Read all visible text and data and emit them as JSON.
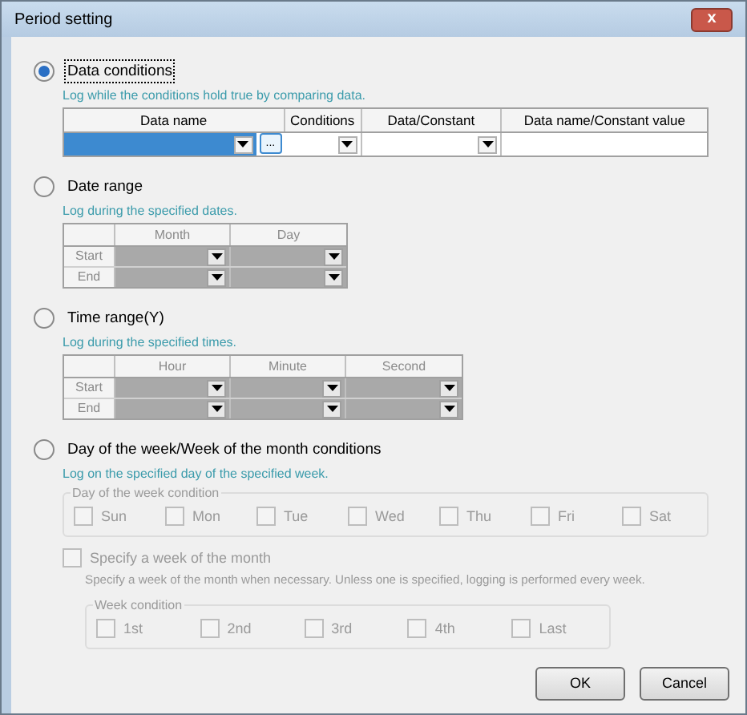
{
  "window": {
    "title": "Period setting",
    "close": "x"
  },
  "sections": [
    {
      "kind": "data_table",
      "label": "Data conditions",
      "selected": true,
      "hint": "Log while the conditions hold true by comparing data.",
      "columns": [
        "Data name",
        "Conditions",
        "Data/Constant",
        "Data name/Constant value"
      ],
      "browse": "..."
    },
    {
      "kind": "range_table",
      "label": "Date range",
      "selected": false,
      "hint": "Log during the specified dates.",
      "columns": [
        "Month",
        "Day"
      ],
      "rows": [
        "Start",
        "End"
      ],
      "disabled": true
    },
    {
      "kind": "range_table",
      "label": "Time range(Y)",
      "selected": false,
      "hint": "Log during the specified times.",
      "columns": [
        "Hour",
        "Minute",
        "Second"
      ],
      "rows": [
        "Start",
        "End"
      ],
      "disabled": true
    },
    {
      "kind": "weekday",
      "label": "Day of the week/Week of the month conditions",
      "selected": false,
      "hint": "Log on the specified day of the specified week.",
      "disabled": true,
      "day_group": {
        "title": "Day of the week condition",
        "items": [
          {
            "label": "Sun",
            "checked": false
          },
          {
            "label": "Mon",
            "checked": false
          },
          {
            "label": "Tue",
            "checked": false
          },
          {
            "label": "Wed",
            "checked": false
          },
          {
            "label": "Thu",
            "checked": false
          },
          {
            "label": "Fri",
            "checked": false
          },
          {
            "label": "Sat",
            "checked": false
          }
        ]
      },
      "week_option": {
        "label": "Specify a week of the month",
        "checked": false,
        "note": "Specify a week of the month when necessary. Unless one is specified, logging is performed every week."
      },
      "week_group": {
        "title": "Week condition",
        "items": [
          {
            "label": "1st",
            "checked": false
          },
          {
            "label": "2nd",
            "checked": false
          },
          {
            "label": "3rd",
            "checked": false
          },
          {
            "label": "4th",
            "checked": false
          },
          {
            "label": "Last",
            "checked": false
          }
        ]
      }
    }
  ],
  "buttons": [
    "OK",
    "Cancel"
  ]
}
